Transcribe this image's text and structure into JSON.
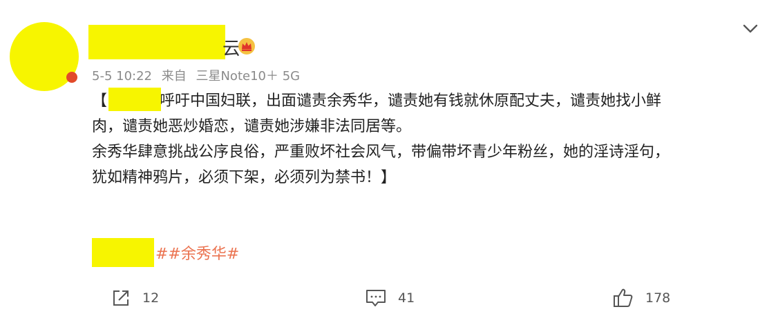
{
  "post": {
    "author": {
      "name_tail": "云"
    },
    "meta": {
      "time": "5-5 10:22",
      "source_prefix": "来自",
      "device": "三星Note10＋ 5G"
    },
    "content": {
      "open_bracket": "【",
      "line1_after_name": "呼吁中国妇联，出面谴责余秀华，谴责她有钱就休原配丈夫，谴责她找小鲜",
      "line2": "肉，谴责她恶炒婚恋，谴责她涉嫌非法同居等。",
      "line3": "余秀华肆意挑战公序良俗，严重败坏社会风气，带偏带坏青少年粉丝，她的淫诗淫句，",
      "line4": "犹如精神鸦片，必须下架，必须列为禁书！】"
    },
    "topic": "##余秀华#",
    "actions": {
      "share_count": "12",
      "comment_count": "41",
      "like_count": "178"
    }
  },
  "colors": {
    "topic": "#eb7350",
    "redaction": "#f7f500",
    "meta_text": "#8a8a8a"
  },
  "icons": {
    "menu": "chevron-down-icon",
    "vip": "vip-crown-icon",
    "share": "share-icon",
    "comment": "comment-icon",
    "like": "thumbs-up-icon"
  }
}
